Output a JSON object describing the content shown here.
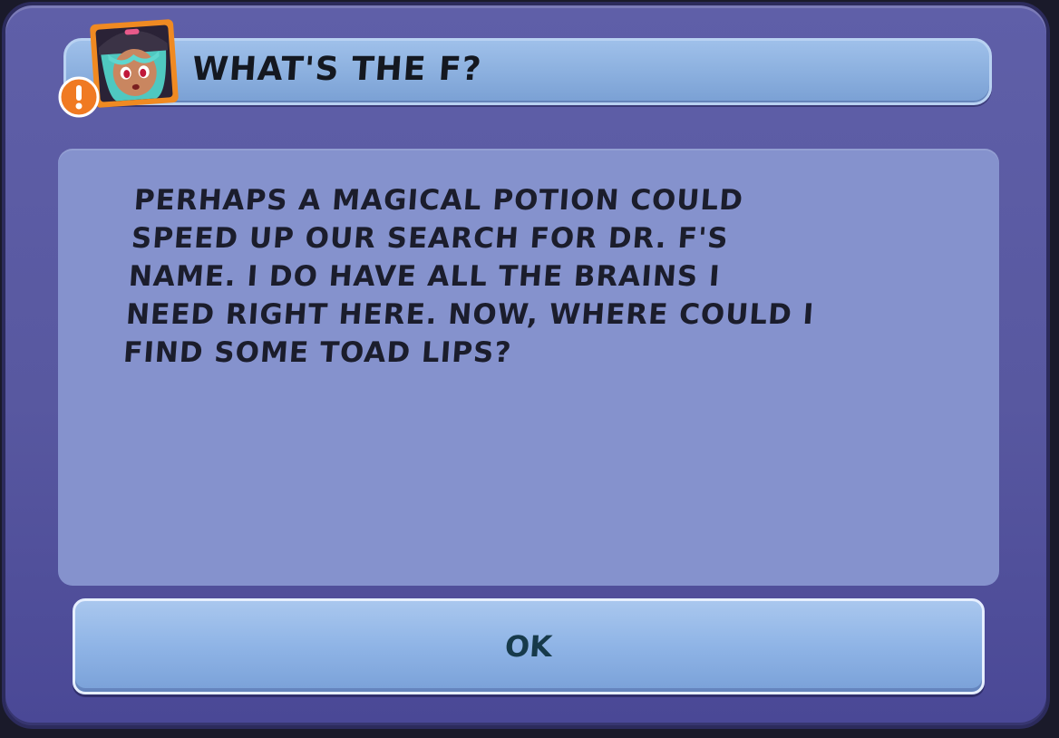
{
  "dialog": {
    "title": "WHAT'S THE F?",
    "portrait_icon": "witch-character-portrait",
    "alert_icon": "exclamation-badge-icon",
    "message": "PERHAPS A MAGICAL POTION COULD\nSPEED UP OUR SEARCH FOR DR. F'S\nNAME. I DO HAVE ALL THE BRAINS I\nNEED RIGHT HERE. NOW, WHERE COULD I\nFIND SOME TOAD LIPS?",
    "ok_label": "OK"
  },
  "colors": {
    "frame": "#5858a0",
    "title_bar": "#8eb2e0",
    "panel": "#8592cd",
    "button": "#8fb4e6",
    "alert": "#f07a22",
    "text": "#1b1d2c",
    "button_text": "#173a4a"
  }
}
